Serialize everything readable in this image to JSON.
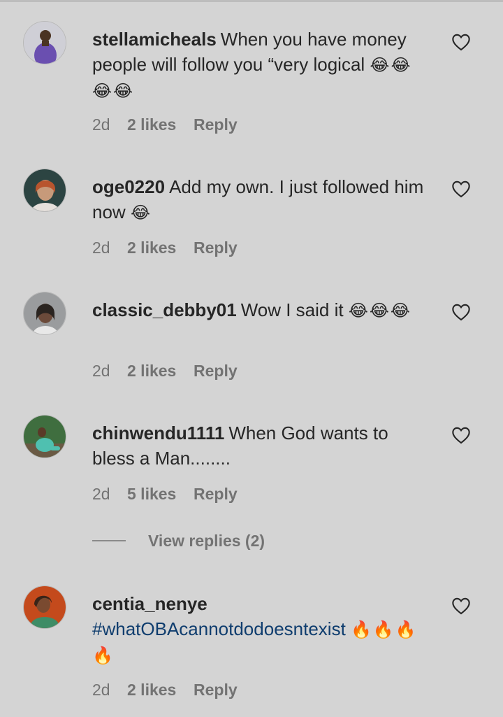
{
  "comments": [
    {
      "username": "stellamicheals",
      "text": "When you have money people will follow you “very logical",
      "emojis": "😂😂😂😂",
      "time": "2d",
      "likes": "2 likes",
      "reply": "Reply",
      "avatar_colors": [
        "#7a62b8",
        "#3d2a6e"
      ]
    },
    {
      "username": "oge0220",
      "text": "Add my own. I just followed him now",
      "emojis": "😂",
      "time": "2d",
      "likes": "2 likes",
      "reply": "Reply",
      "avatar_colors": [
        "#2a4a48",
        "#c7a58a"
      ]
    },
    {
      "username": "classic_debby01",
      "text": "Wow I said it",
      "emojis": "😂😂😂",
      "time": "2d",
      "likes": "2 likes",
      "reply": "Reply",
      "avatar_colors": [
        "#8a8d90",
        "#e0e0e0"
      ]
    },
    {
      "username": "chinwendu1111",
      "text": "When God wants to bless a Man........",
      "emojis": "",
      "time": "2d",
      "likes": "5 likes",
      "reply": "Reply",
      "avatar_colors": [
        "#2f6a3a",
        "#5bbfb2"
      ]
    },
    {
      "username": "centia_nenye",
      "text": "#whatOBAcannotdodoesntexist",
      "emojis": "🔥🔥🔥🔥",
      "time": "2d",
      "likes": "2 likes",
      "reply": "Reply",
      "avatar_colors": [
        "#c24a1a",
        "#4a9a70"
      ]
    }
  ],
  "view_replies": "View replies (2)",
  "icons": {
    "like": "heart-outline-icon"
  },
  "colors": {
    "background": "#d4d4d4",
    "text": "#262626",
    "meta": "#737373",
    "hashtag": "#0f3d6e"
  }
}
